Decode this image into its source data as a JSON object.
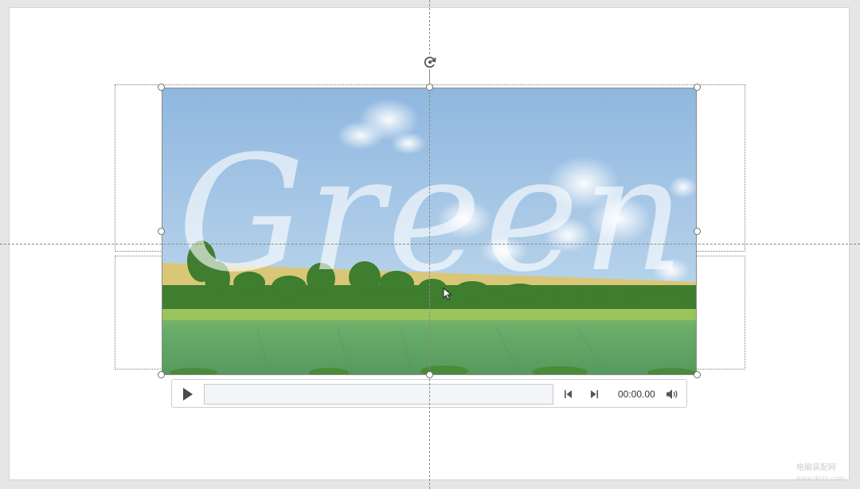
{
  "slide": {
    "video": {
      "overlay_text": "Green",
      "colors": {
        "sky_top": "#8fb7df",
        "sky_bottom": "#c8dff0",
        "field": "#5fa466",
        "trees": "#3f7d2f",
        "wheat": "#d9c777",
        "overlay_text": "#ffffff"
      }
    },
    "media_controls": {
      "play_icon": "play-icon",
      "skip_back_icon": "skip-back-icon",
      "skip_forward_icon": "skip-forward-icon",
      "time": "00:00.00",
      "volume_icon": "volume-icon"
    }
  },
  "watermark": {
    "line1": "电脑装配网",
    "line2": "www.dnzp.com"
  }
}
